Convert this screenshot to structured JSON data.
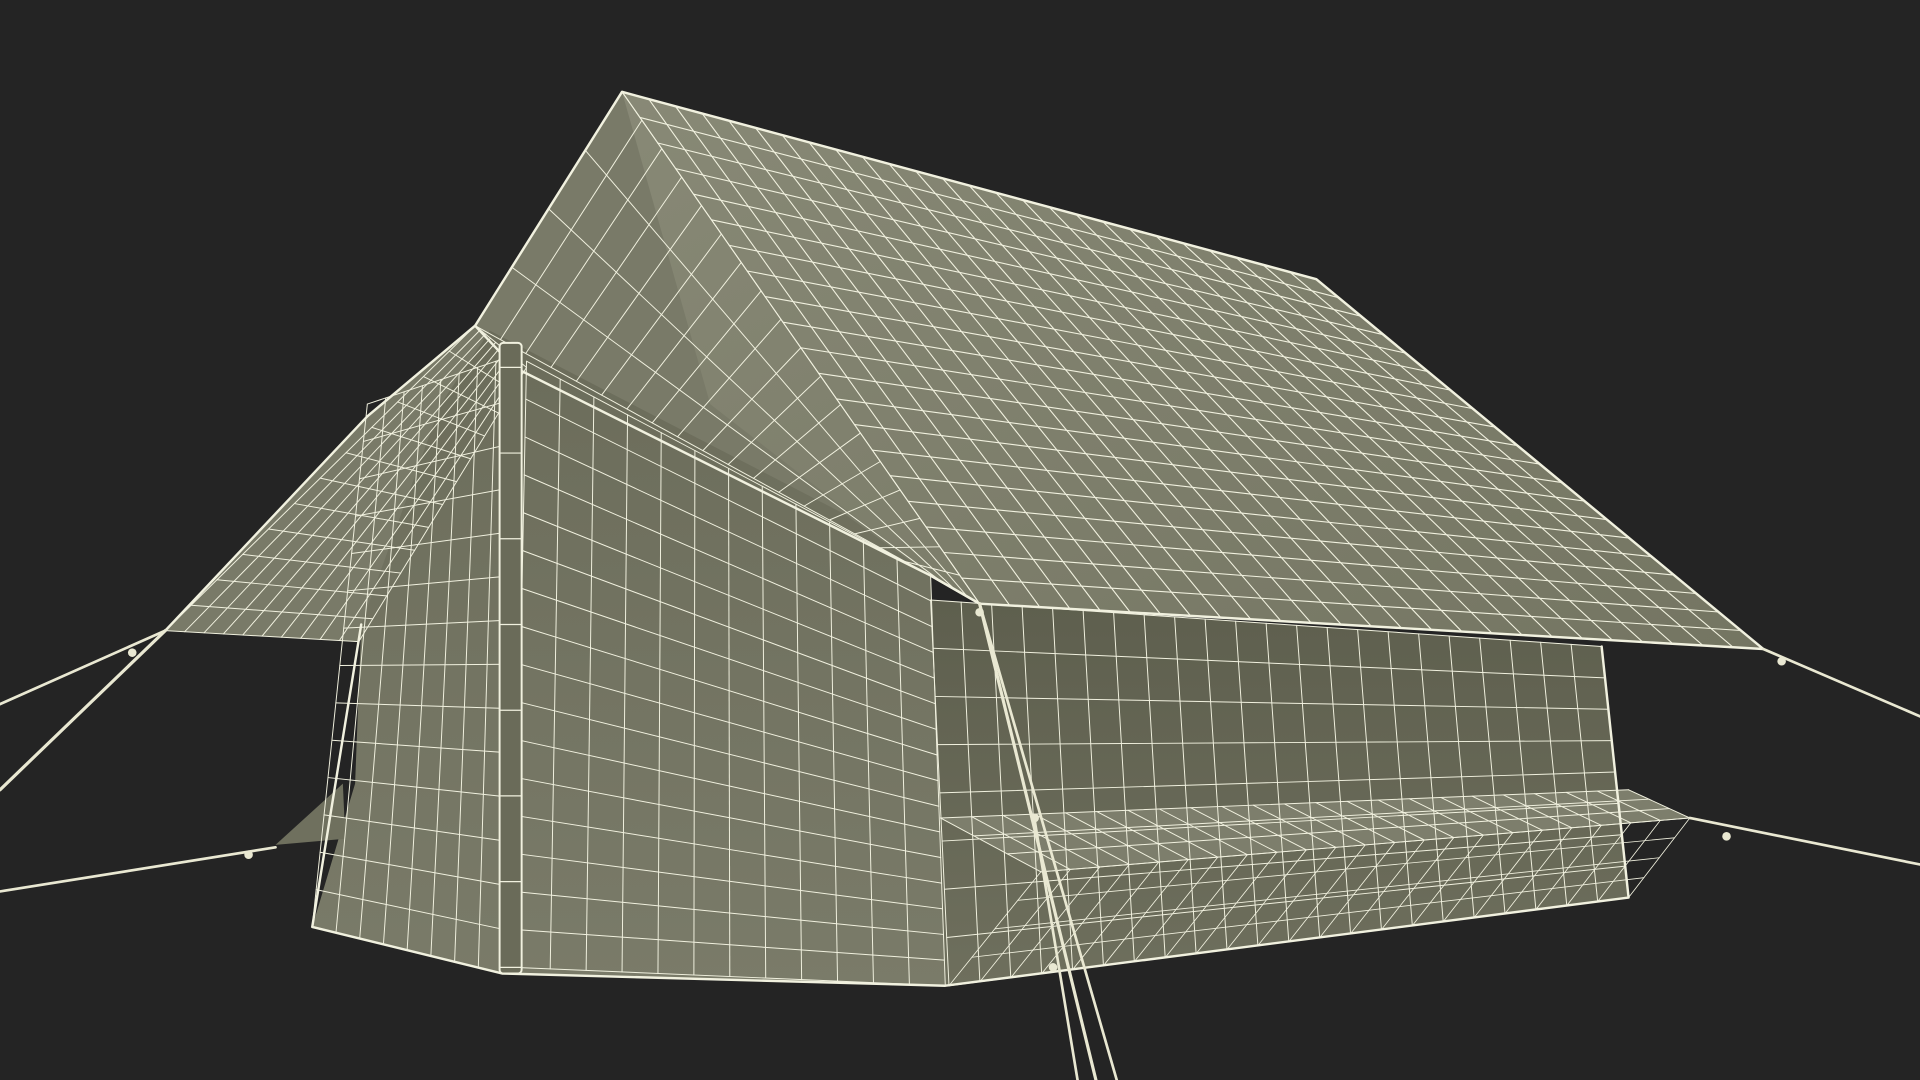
{
  "scene": {
    "subject": "tent-wireframe-render",
    "colors": {
      "background": "#242424",
      "fabric_light": "#7c7d6b",
      "fabric_mid": "#72735f",
      "fabric_dark": "#5d5e4d",
      "wire": "#f1f1df",
      "rope": "#e9e8d2"
    }
  }
}
